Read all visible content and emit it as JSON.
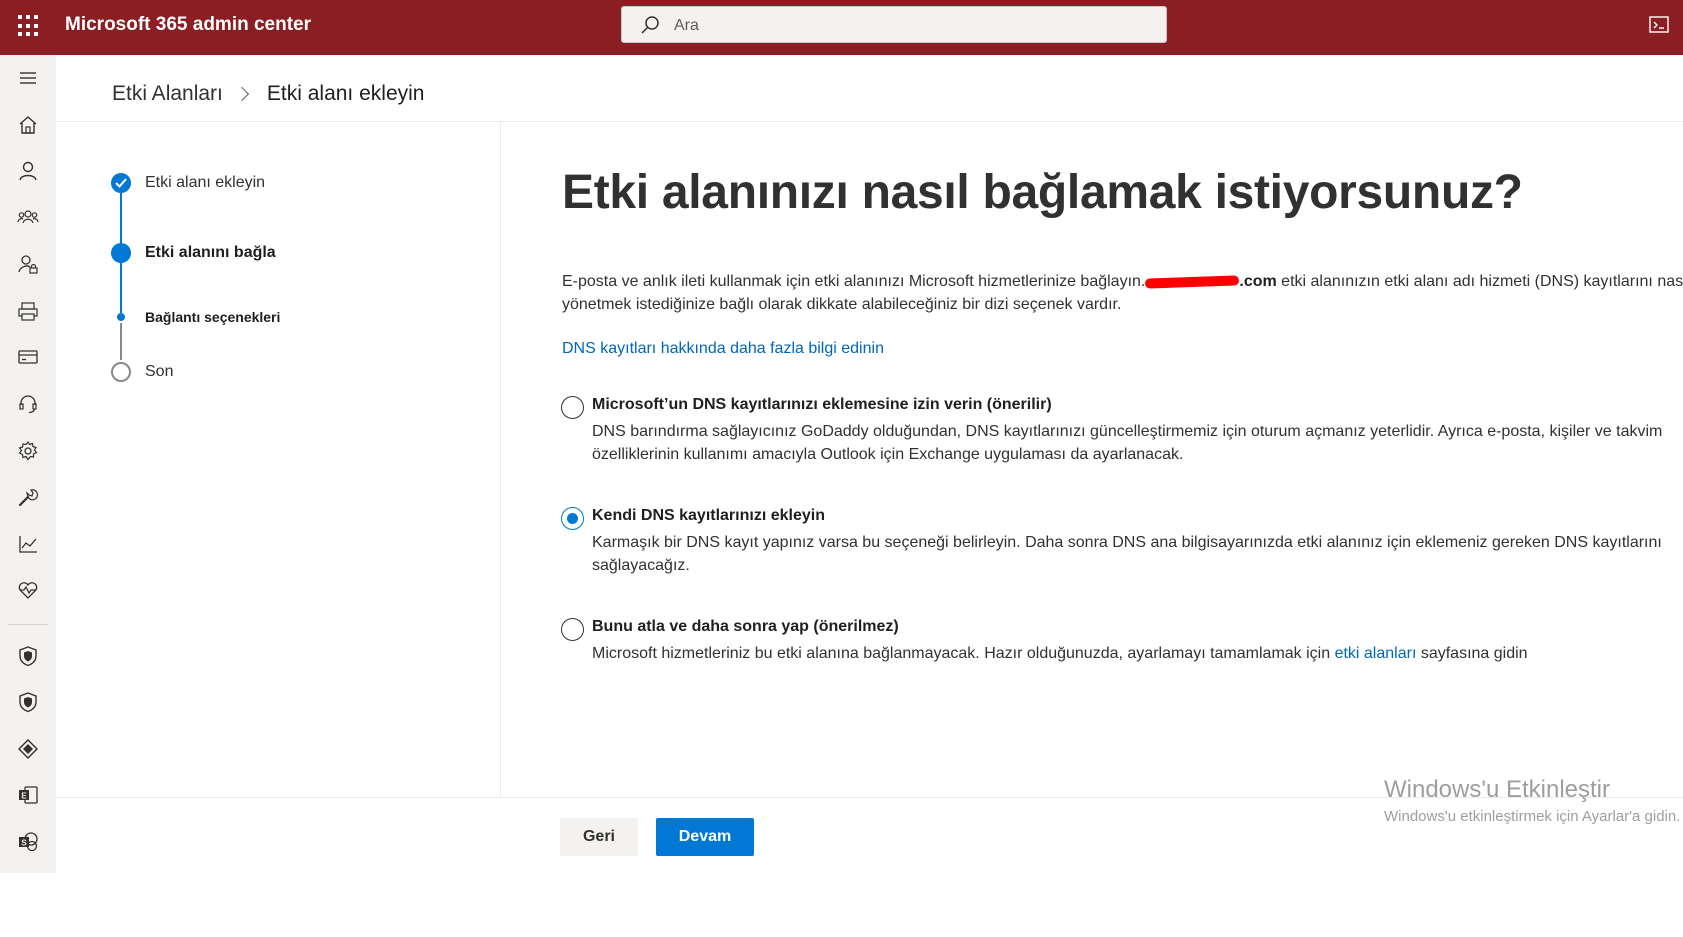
{
  "app": {
    "title": "Microsoft 365 admin center",
    "search_placeholder": "Ara"
  },
  "colors": {
    "topbar": "#8a1e22",
    "accent": "#0078d4",
    "link": "#0067b8"
  },
  "nav_icons": [
    "menu-icon",
    "home-icon",
    "user-icon",
    "groups-icon",
    "roles-icon",
    "resources-icon",
    "billing-icon",
    "support-icon",
    "settings-icon",
    "setup-icon",
    "reports-icon",
    "health-icon",
    "security-icon",
    "compliance-icon",
    "endpoint-icon",
    "exchange-icon",
    "sharepoint-icon"
  ],
  "breadcrumb": {
    "parent": "Etki Alanları",
    "current": "Etki alanı ekleyin"
  },
  "steps": [
    {
      "label": "Etki alanı ekleyin",
      "state": "done"
    },
    {
      "label": "Etki alanını bağla",
      "state": "current"
    },
    {
      "label": "Bağlantı seçenekleri",
      "state": "sub-current"
    },
    {
      "label": "Son",
      "state": "todo"
    }
  ],
  "main": {
    "title": "Etki alanınızı nasıl bağlamak istiyorsunuz?",
    "intro_part1": "E-posta ve anlık ileti kullanmak için etki alanınızı Microsoft hizmetlerinize bağlayın.",
    "intro_domain_suffix": ".com",
    "intro_part2": " etki alanınızın etki alanı adı hizmeti (DNS) kayıtlarını nasıl",
    "intro_line2": "yönetmek istediğinize bağlı olarak dikkate alabileceğiniz bir dizi seçenek vardır.",
    "dns_link": "DNS kayıtları hakkında daha fazla bilgi edinin"
  },
  "options": [
    {
      "title": "Microsoft’un DNS kayıtlarınızı eklemesine izin verin (önerilir)",
      "desc_line1": "DNS barındırma sağlayıcınız GoDaddy olduğundan, DNS kayıtlarınızı güncelleştirmemiz için oturum açmanız yeterlidir. Ayrıca e-posta, kişiler ve takvim",
      "desc_line2": "özelliklerinin kullanımı amacıyla Outlook için Exchange uygulaması da ayarlanacak.",
      "selected": false
    },
    {
      "title": "Kendi DNS kayıtlarınızı ekleyin",
      "desc_line1": "Karmaşık bir DNS kayıt yapınız varsa bu seçeneği belirleyin. Daha sonra DNS ana bilgisayarınızda etki alanınız için eklemeniz gereken DNS kayıtlarını",
      "desc_line2": "sağlayacağız.",
      "selected": true
    },
    {
      "title": "Bunu atla ve daha sonra yap (önerilmez)",
      "desc_part1": "Microsoft hizmetleriniz bu etki alanına bağlanmayacak. Hazır olduğunuzda, ayarlamayı tamamlamak için ",
      "desc_link": "etki alanları",
      "desc_part2": " sayfasına gidin",
      "selected": false
    }
  ],
  "buttons": {
    "back": "Geri",
    "next": "Devam"
  },
  "watermark": {
    "line1": "Windows'u Etkinleştir",
    "line2": "Windows'u etkinleştirmek için Ayarlar'a gidin."
  }
}
